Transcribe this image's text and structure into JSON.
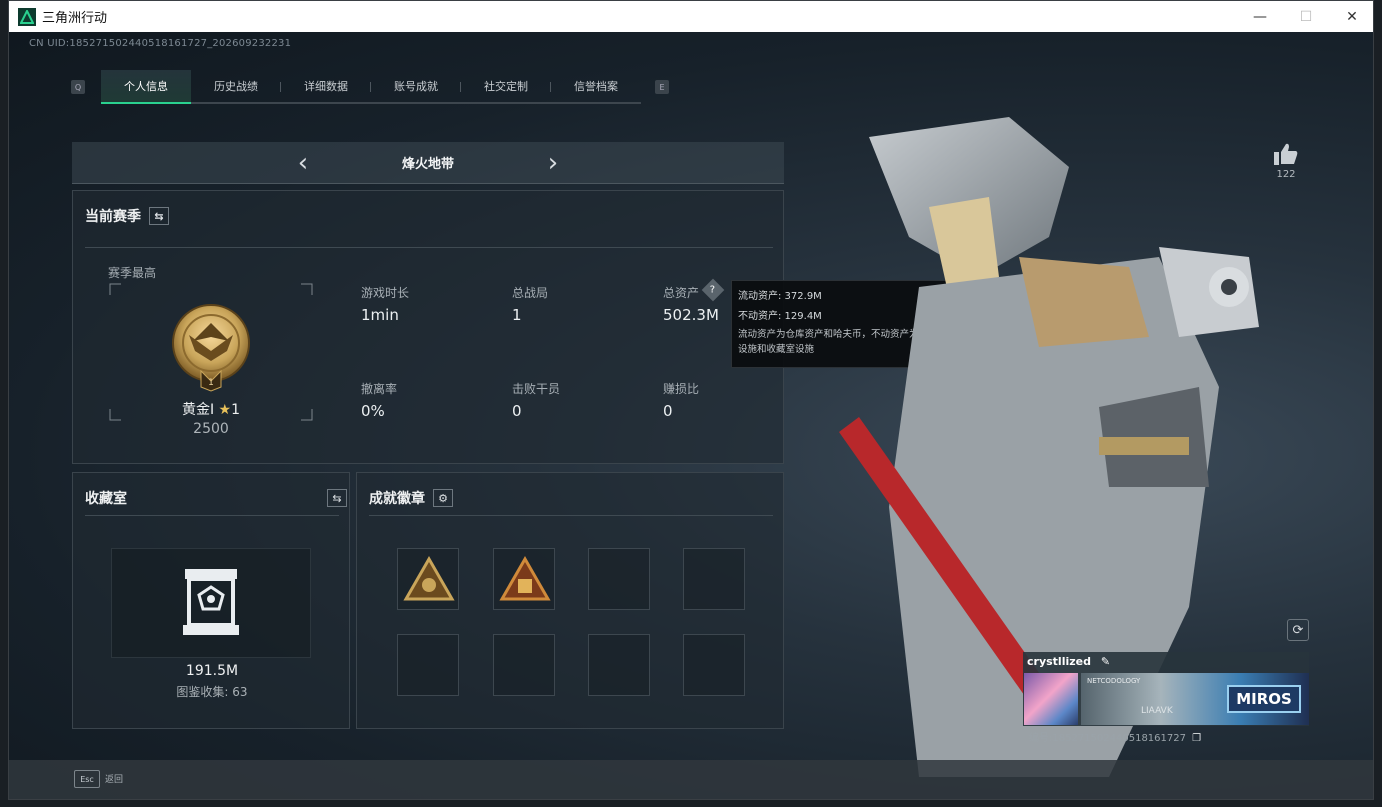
{
  "window": {
    "title": "三角洲行动",
    "minimize_icon": "—",
    "maximize_icon": "☐",
    "close_icon": "✕"
  },
  "uid_line": "CN UID:185271502440518161727_202609232231",
  "tabs": {
    "left_key": "Q",
    "right_key": "E",
    "items": [
      {
        "label": "个人信息",
        "active": true
      },
      {
        "label": "历史战绩",
        "active": false
      },
      {
        "label": "详细数据",
        "active": false
      },
      {
        "label": "账号成就",
        "active": false
      },
      {
        "label": "社交定制",
        "active": false
      },
      {
        "label": "信誉档案",
        "active": false
      }
    ]
  },
  "map_selector": {
    "name": "烽火地带",
    "prev_icon": "‹",
    "next_icon": "›"
  },
  "season_panel": {
    "title": "当前赛季",
    "switch_icon": "⇆",
    "season_best_label": "赛季最高",
    "rank_name": "黄金I",
    "rank_star_icon": "★",
    "rank_stars": "1",
    "rank_medal_number": "1",
    "rank_points": "2500",
    "stats": [
      {
        "label": "游戏时长",
        "value": "1min"
      },
      {
        "label": "总战局",
        "value": "1"
      },
      {
        "label": "总资产",
        "value": "502.3M",
        "help_icon": "?"
      },
      {
        "label": "撤离率",
        "value": "0%"
      },
      {
        "label": "击败干员",
        "value": "0"
      },
      {
        "label": "赚损比",
        "value": "0"
      }
    ]
  },
  "tooltip": {
    "liquid_assets": "流动资产: 372.9M",
    "fixed_assets": "不动资产: 129.4M",
    "note": "流动资产为仓库资产和哈夫币，不动资产为特勤处设施和收藏室设施"
  },
  "collection_panel": {
    "title": "收藏室",
    "switch_icon": "⇆",
    "value": "191.5M",
    "collection_count": "图鉴收集: 63"
  },
  "badge_panel": {
    "title": "成就徽章",
    "settings_icon": "⚙"
  },
  "right_side": {
    "like_icon": "👍",
    "like_count": "122",
    "refresh_icon": "⟳",
    "player_name": "crystllized",
    "edit_icon": "✎",
    "banner_text_left": "NETCODOLOGY",
    "banner_text_mid": "LIAAVK",
    "banner_text_right": "MIROS",
    "player_uid": "编号:185271502440518161727",
    "copy_icon": "❐"
  },
  "bottom": {
    "esc_key": "Esc",
    "esc_label": "返回"
  },
  "colors": {
    "accent": "#2ad18f",
    "gold": "#c9a55a",
    "text": "#ecf0f2"
  }
}
